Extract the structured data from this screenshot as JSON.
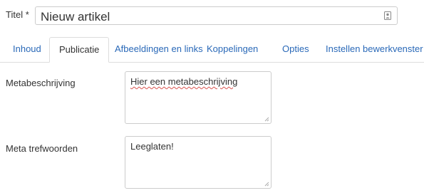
{
  "title_field": {
    "label": "Titel *",
    "value": "Nieuw artikel",
    "icon": "contact-card-icon"
  },
  "tabs": [
    {
      "label": "Inhoud",
      "active": false
    },
    {
      "label": "Publicatie",
      "active": true
    },
    {
      "label": "Afbeeldingen en links",
      "active": false
    },
    {
      "label": "Koppelingen",
      "active": false
    },
    {
      "label": "Opties",
      "active": false
    },
    {
      "label": "Instellen bewerkvenster",
      "active": false
    }
  ],
  "fields": {
    "meta_description": {
      "label": "Metabeschrijving",
      "value": "Hier een metabeschrijving"
    },
    "meta_keywords": {
      "label": "Meta trefwoorden",
      "value": "Leeglaten!"
    }
  },
  "colors": {
    "link": "#2a69b8",
    "border": "#cccccc",
    "spellcheck": "#d9534f"
  }
}
